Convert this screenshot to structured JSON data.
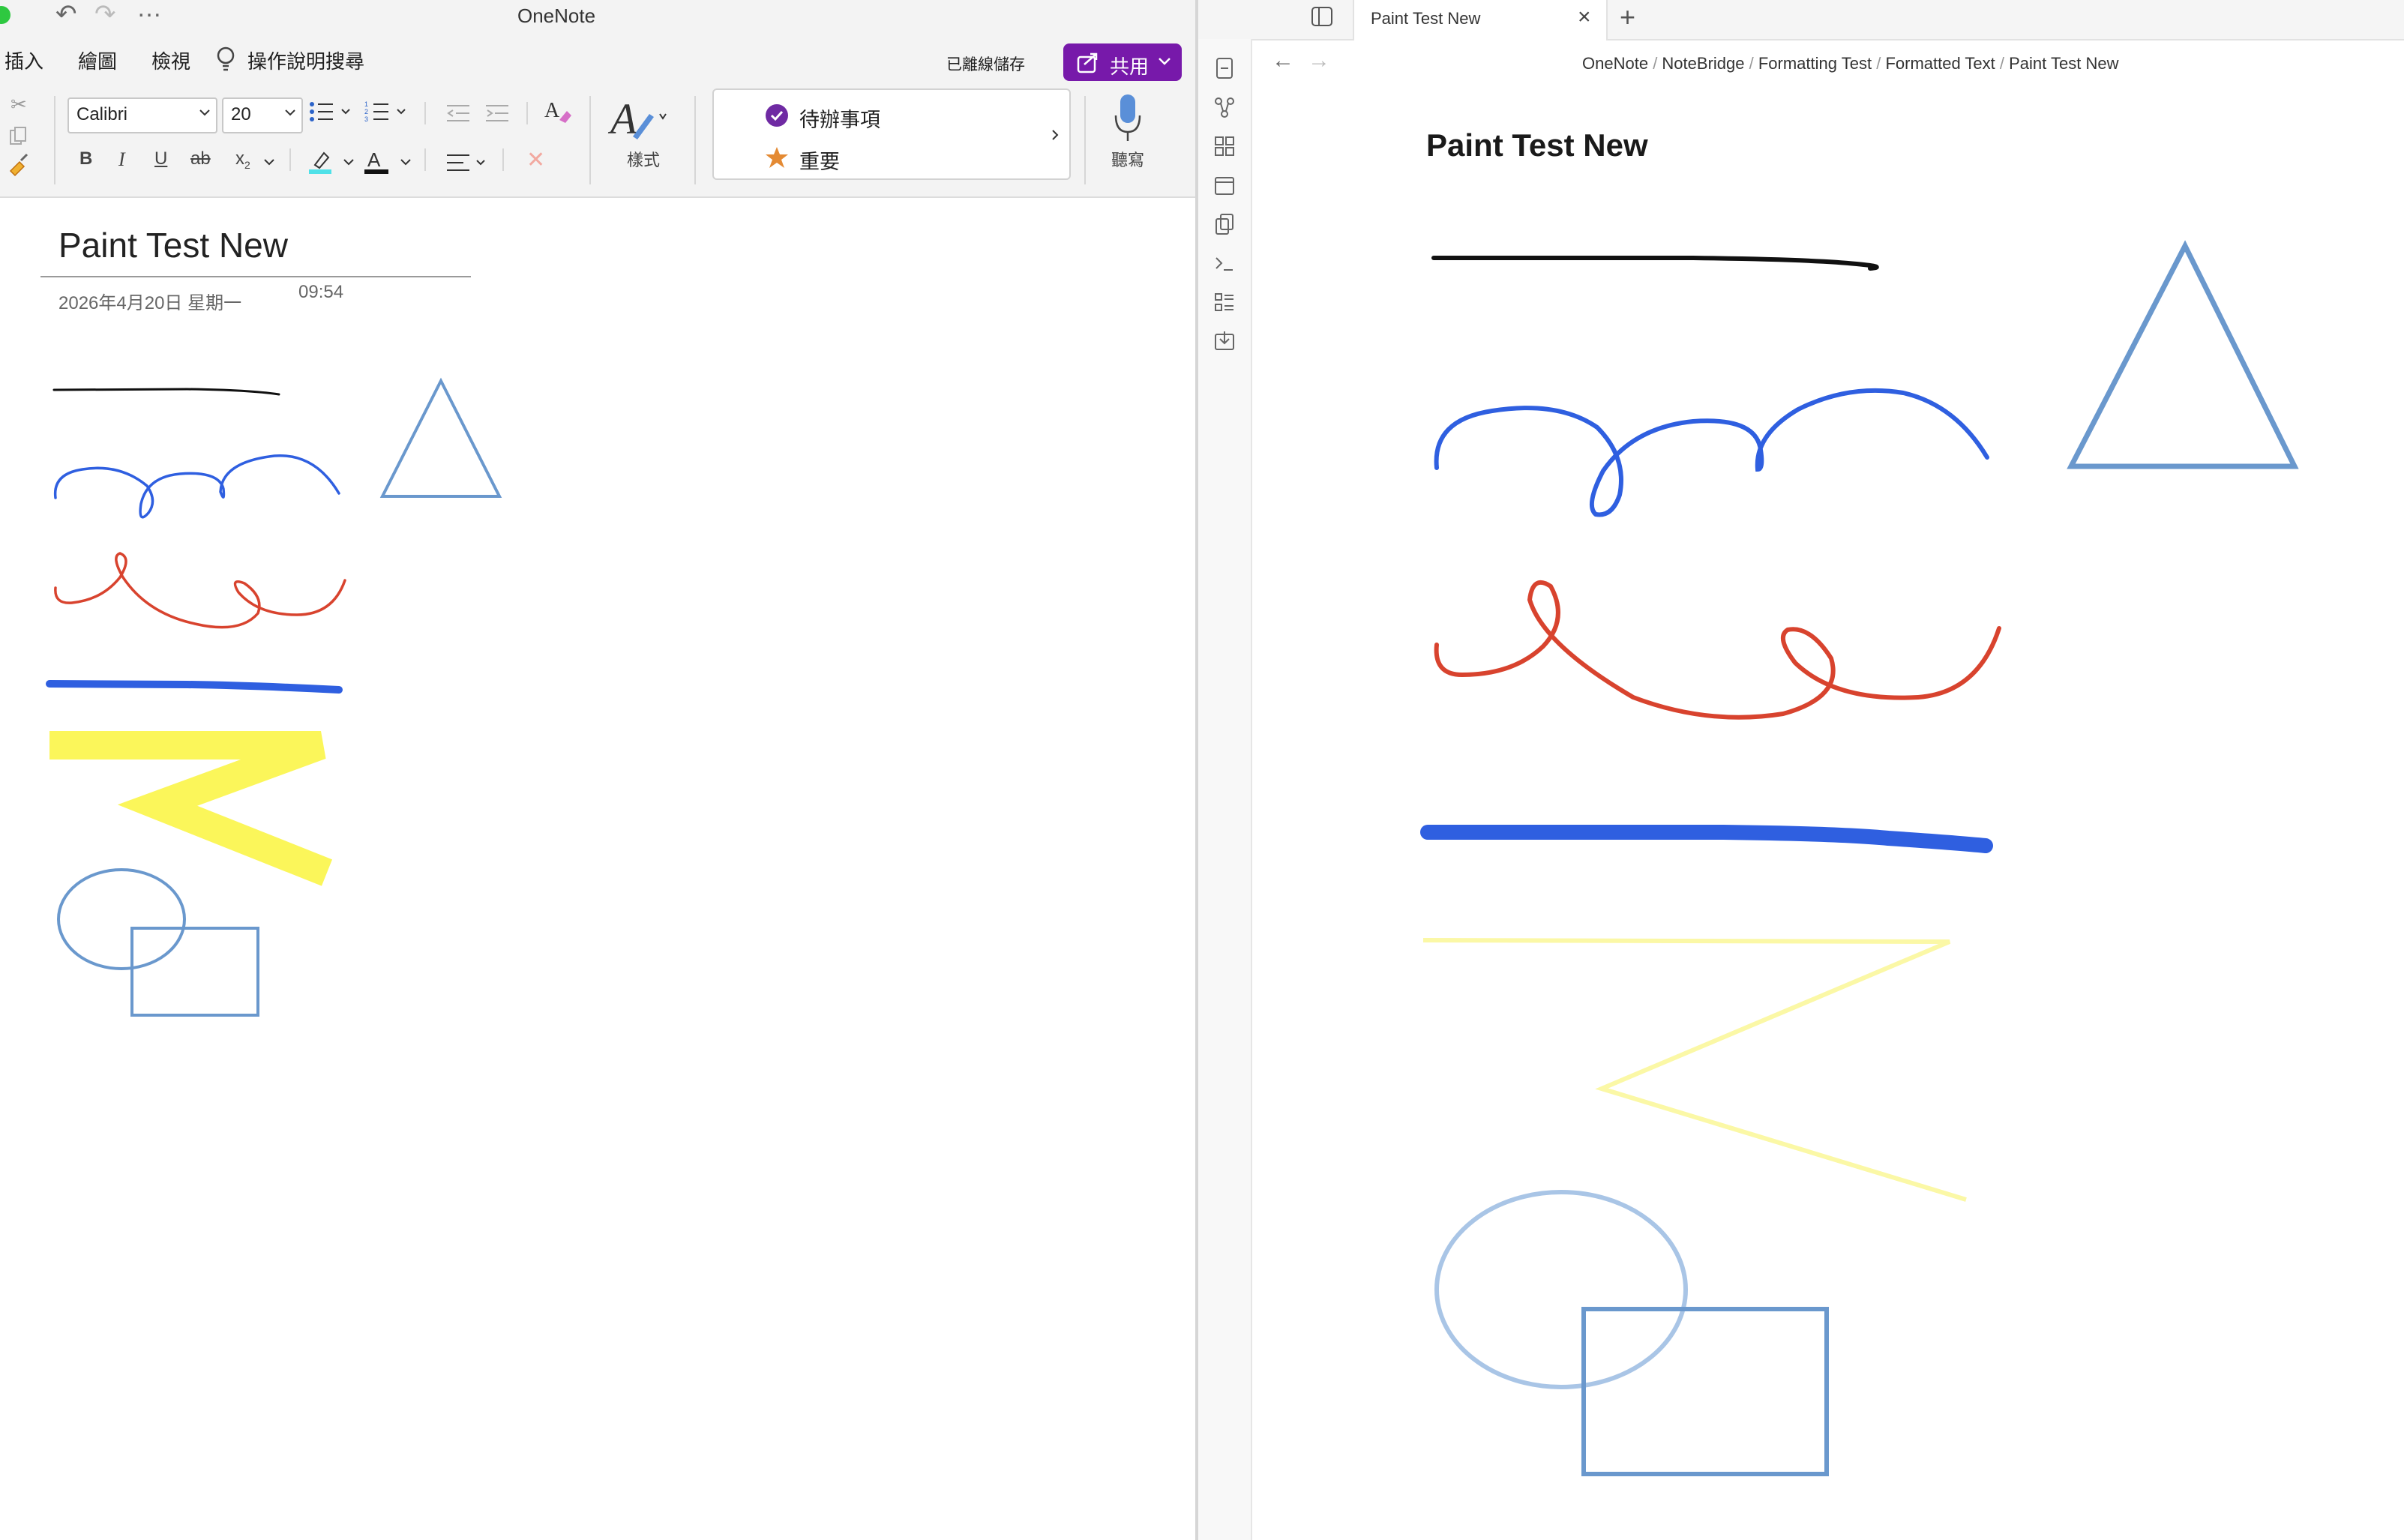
{
  "onenote": {
    "app_title": "OneNote",
    "ribbon_tabs": [
      "插入",
      "繪圖",
      "檢視"
    ],
    "help_search": "操作說明搜尋",
    "save_status": "已離線儲存",
    "share_label": "共用",
    "font_name": "Calibri",
    "font_size": "20",
    "styles_label": "樣式",
    "dictate_label": "聽寫",
    "tags": [
      "待辦事項",
      "重要"
    ],
    "page": {
      "title": "Paint Test New",
      "date": "2026年4月20日 星期一",
      "time": "09:54"
    },
    "colors": {
      "accent": "#7719aa",
      "ink_black": "#111111",
      "ink_blue": "#2f5fe0",
      "ink_red": "#d8432e",
      "highlighter_yellow": "#fbf65a",
      "shape_blue": "#6a98cd"
    }
  },
  "notebridge": {
    "tab_title": "Paint Test New",
    "breadcrumbs": [
      "OneNote",
      "NoteBridge",
      "Formatting Test",
      "Formatted Text",
      "Paint Test New"
    ],
    "page_title": "Paint Test New",
    "rail_icons": [
      "new-note-icon",
      "graph-icon",
      "grid-icon",
      "calendar-icon",
      "copy-icon",
      "terminal-icon",
      "list-icon",
      "import-icon"
    ]
  }
}
